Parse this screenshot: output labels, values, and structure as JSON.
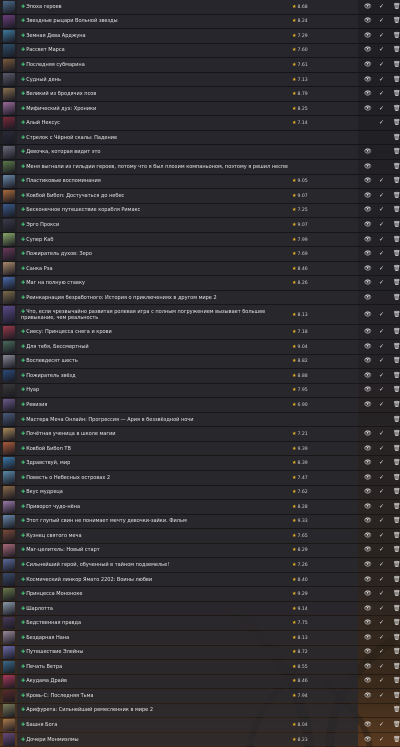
{
  "accent": "#49d07e",
  "star_color": "#f0b429",
  "rows": [
    {
      "title": "Эпоха героев",
      "rating": "8.68",
      "eye": true,
      "check": true,
      "thumb": "#4c6a8a"
    },
    {
      "title": "Звездные рыцари Вольной звезды",
      "rating": "8.24",
      "eye": true,
      "check": true,
      "thumb": "#6b3d7a"
    },
    {
      "title": "Земная Дева Арджуна",
      "rating": "7.29",
      "eye": true,
      "check": true,
      "thumb": "#3f7aa0"
    },
    {
      "title": "Рассвет Марса",
      "rating": "7.60",
      "eye": true,
      "check": true,
      "thumb": "#2f4f6a"
    },
    {
      "title": "Последняя субмарина",
      "rating": "7.61",
      "eye": true,
      "check": true,
      "thumb": "#7a5a3c"
    },
    {
      "title": "Судный день",
      "rating": "7.13",
      "eye": true,
      "check": true,
      "thumb": "#5a5a6a"
    },
    {
      "title": "Великий из бродячих псов",
      "rating": "8.79",
      "eye": true,
      "check": true,
      "thumb": "#8a7050"
    },
    {
      "title": "Мифический дух: Хроники",
      "rating": "8.25",
      "eye": true,
      "check": true,
      "thumb": "#9a6a9a"
    },
    {
      "title": "Алый Нексус",
      "rating": "7.14",
      "eye": false,
      "check": true,
      "thumb": "#7a2a3a"
    },
    {
      "title": "Стрелок с Чёрной скалы: Падение",
      "rating": "",
      "eye": false,
      "check": false,
      "thumb": "#2a2a3a"
    },
    {
      "title": "Девочка, которая видит это",
      "rating": "",
      "eye": true,
      "check": false,
      "thumb": "#6a6a7a"
    },
    {
      "title": "Меня выгнали из гильдии героев, потому что я был плохим компаньоном, поэтому я решил неспешно жить в глуши",
      "rating": "",
      "eye": true,
      "check": false,
      "thumb": "#5a7a4a"
    },
    {
      "title": "Пластиковые воспоминания",
      "rating": "9.05",
      "eye": true,
      "check": true,
      "thumb": "#6a8aaa"
    },
    {
      "title": "Ковбой Бибоп: Достучаться до небес",
      "rating": "9.07",
      "eye": true,
      "check": true,
      "thumb": "#aa6a3a"
    },
    {
      "title": "Бесконечное путешествие корабля Римакс",
      "rating": "7.25",
      "eye": true,
      "check": true,
      "thumb": "#3a5a8a"
    },
    {
      "title": "Эрго Прокси",
      "rating": "9.07",
      "eye": true,
      "check": true,
      "thumb": "#3a3a4a"
    },
    {
      "title": "Супер Каб",
      "rating": "7.99",
      "eye": true,
      "check": true,
      "thumb": "#8aaa6a"
    },
    {
      "title": "Пожиратель духов: Зеро",
      "rating": "7.69",
      "eye": true,
      "check": true,
      "thumb": "#6a3a5a"
    },
    {
      "title": "Санка Рэа",
      "rating": "8.46",
      "eye": true,
      "check": true,
      "thumb": "#aa8a6a"
    },
    {
      "title": "Маг на полную ставку",
      "rating": "8.26",
      "eye": true,
      "check": true,
      "thumb": "#4a6aaa"
    },
    {
      "title": "Реинкарнация безработного: История о приключениях в другом мире 2",
      "rating": "",
      "eye": true,
      "check": false,
      "thumb": "#7a6a4a"
    },
    {
      "title": "Что, если чрезвычайно развитая ролевая игра с полным погружением вызывает большее привыкание, чем реальность",
      "rating": "8.13",
      "eye": true,
      "check": true,
      "thumb": "#5a4a8a",
      "tall": true
    },
    {
      "title": "Сиесу: Принцесса снега и крови",
      "rating": "7.18",
      "eye": true,
      "check": true,
      "thumb": "#9a3a4a"
    },
    {
      "title": "Для тебя, Бессмертный",
      "rating": "9.04",
      "eye": true,
      "check": true,
      "thumb": "#4a6a5a"
    },
    {
      "title": "Воспевдесят шесть",
      "rating": "8.82",
      "eye": true,
      "check": true,
      "thumb": "#8a8a9a"
    },
    {
      "title": "Пожиратель звёзд",
      "rating": "8.88",
      "eye": true,
      "check": true,
      "thumb": "#2a4a7a"
    },
    {
      "title": "Нуар",
      "rating": "7.95",
      "eye": true,
      "check": true,
      "thumb": "#3a3a3a"
    },
    {
      "title": "Ревизия",
      "rating": "6.90",
      "eye": true,
      "check": true,
      "thumb": "#6a5a8a"
    },
    {
      "title": "Мастера Меча Онлайн: Прогрессия — Ария в беззвёздной ночи",
      "rating": "",
      "eye": false,
      "check": false,
      "thumb": "#4a5a7a"
    },
    {
      "title": "Почётная ученица в школе магии",
      "rating": "7.21",
      "eye": true,
      "check": true,
      "thumb": "#aa8a5a"
    },
    {
      "title": "Ковбой Бибоп ТВ",
      "rating": "9.39",
      "eye": true,
      "check": true,
      "thumb": "#aa5a3a"
    },
    {
      "title": "Здравствуй, мир",
      "rating": "8.39",
      "eye": true,
      "check": true,
      "thumb": "#3a7aaa"
    },
    {
      "title": "Повесть о Небесных островах 2",
      "rating": "7.47",
      "eye": true,
      "check": true,
      "thumb": "#5a8aaa"
    },
    {
      "title": "Вкус мудреца",
      "rating": "7.62",
      "eye": true,
      "check": true,
      "thumb": "#8a6a4a"
    },
    {
      "title": "Приворот чудо-нёна",
      "rating": "8.28",
      "eye": true,
      "check": true,
      "thumb": "#9a7aaa"
    },
    {
      "title": "Этот глупый свин не понимает мечту девочки-зайки. Фильм",
      "rating": "9.33",
      "eye": true,
      "check": true,
      "thumb": "#6a8aaa"
    },
    {
      "title": "Кузнец святого меча",
      "rating": "7.65",
      "eye": true,
      "check": true,
      "thumb": "#7a4a3a"
    },
    {
      "title": "Маг-целитель: Новый старт",
      "rating": "8.29",
      "eye": true,
      "check": true,
      "thumb": "#aa6a7a"
    },
    {
      "title": "Сильнейший герой, обученный в тайном подземелье!",
      "rating": "7.26",
      "eye": true,
      "check": true,
      "thumb": "#5a6a9a"
    },
    {
      "title": "Космический линкор Ямато 2202: Воины любви",
      "rating": "8.40",
      "eye": true,
      "check": true,
      "thumb": "#3a4a6a"
    },
    {
      "title": "Принцесса Мононоке",
      "rating": "9.29",
      "eye": true,
      "check": true,
      "thumb": "#6a7a4a"
    },
    {
      "title": "Шарлотта",
      "rating": "9.14",
      "eye": true,
      "check": true,
      "thumb": "#8a9aaa"
    },
    {
      "title": "Бедственная правда",
      "rating": "7.75",
      "eye": true,
      "check": true,
      "thumb": "#4a3a5a"
    },
    {
      "title": "Бездарная Нана",
      "rating": "8.13",
      "eye": true,
      "check": true,
      "thumb": "#9a8a9a"
    },
    {
      "title": "Путешествие Элейны",
      "rating": "8.72",
      "eye": true,
      "check": true,
      "thumb": "#6a6aaa"
    },
    {
      "title": "Печать Ветра",
      "rating": "8.55",
      "eye": true,
      "check": true,
      "thumb": "#3a6a8a"
    },
    {
      "title": "Акудама Драйв",
      "rating": "8.46",
      "eye": true,
      "check": true,
      "thumb": "#aa3a5a"
    },
    {
      "title": "Кровь-С: Последняя Тьма",
      "rating": "7.94",
      "eye": true,
      "check": true,
      "thumb": "#5a2a2a"
    },
    {
      "title": "Арифурета: Сильнейший ремесленник в мире 2",
      "rating": "",
      "eye": false,
      "check": false,
      "thumb": "#7a7a5a"
    },
    {
      "title": "Башня Бога",
      "rating": "8.04",
      "eye": true,
      "check": true,
      "thumb": "#aa7a4a"
    },
    {
      "title": "Дочери Монмиэлмы",
      "rating": "8.23",
      "eye": true,
      "check": true,
      "thumb": "#6a4a7a"
    }
  ]
}
